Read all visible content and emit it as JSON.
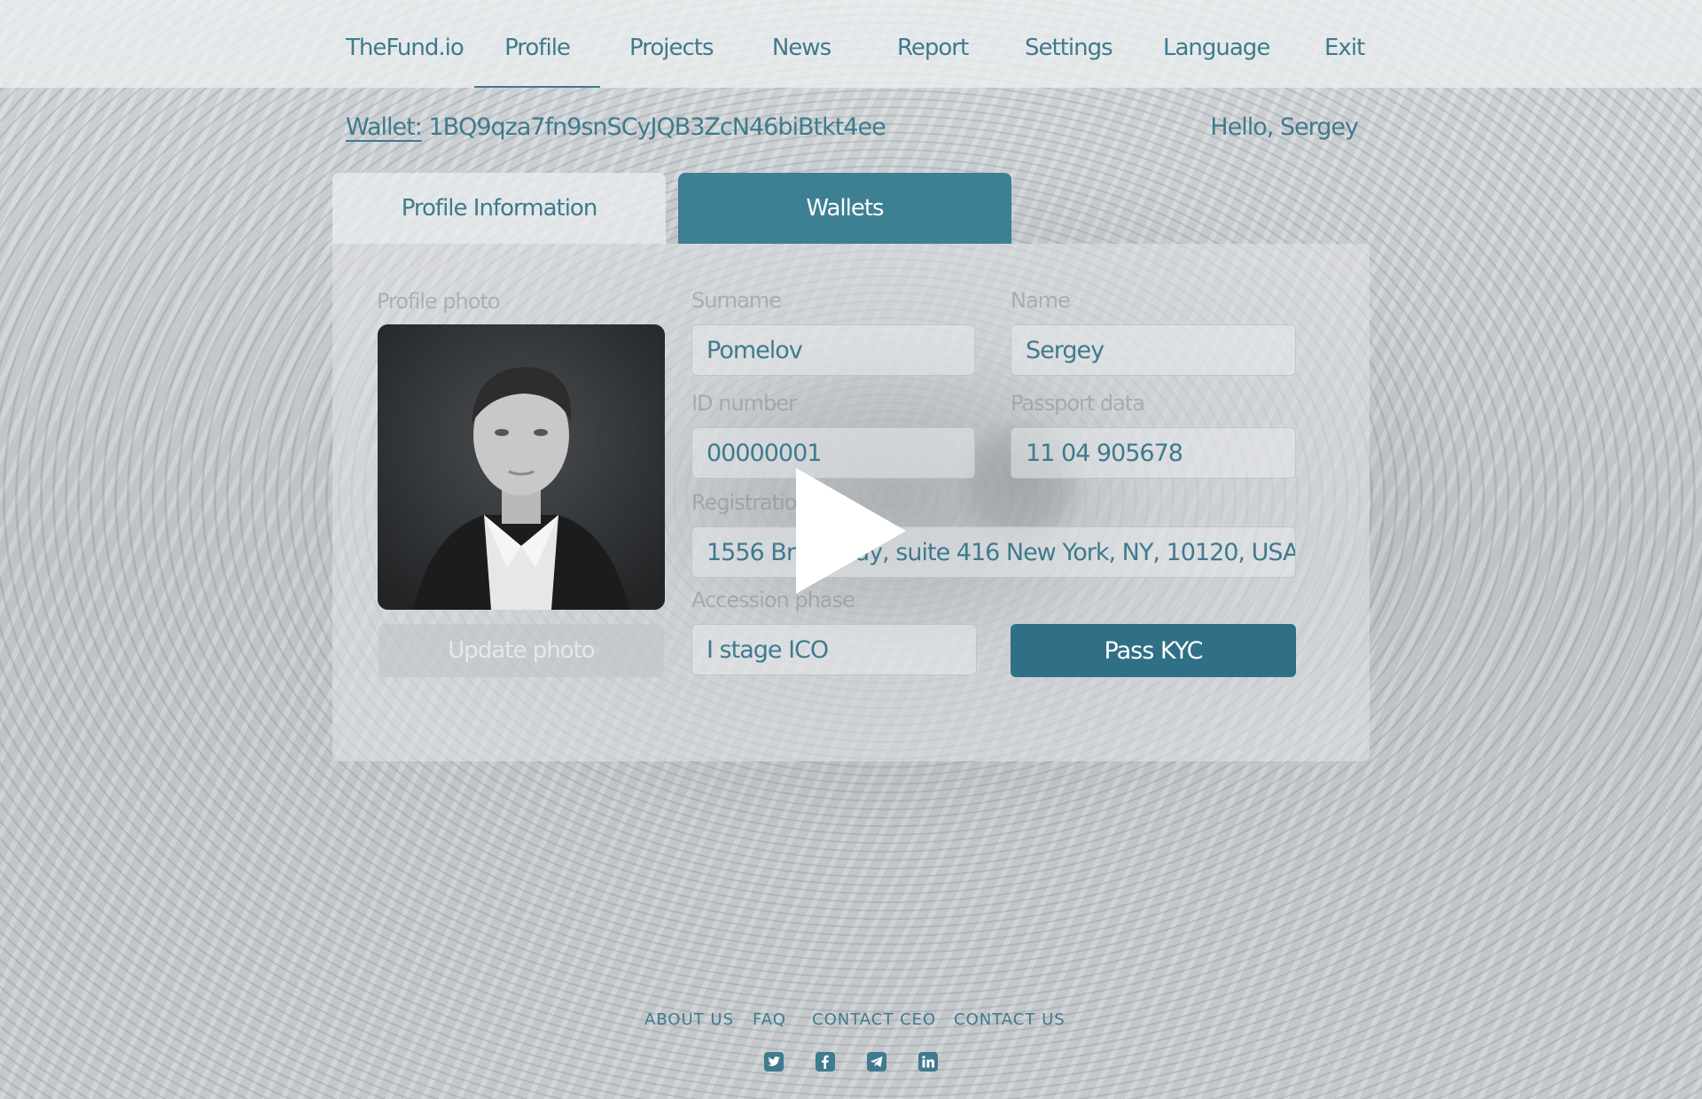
{
  "nav": {
    "brand": "TheFund.io",
    "items": [
      "Profile",
      "Projects",
      "News",
      "Report",
      "Settings",
      "Language",
      "Exit"
    ],
    "active": "Profile"
  },
  "wallet": {
    "label": "Wallet:",
    "address": "1BQ9qza7fn9snSCyJQB3ZcN46biBtkt4ee"
  },
  "greeting": "Hello, Sergey",
  "tabs": {
    "profile": "Profile Information",
    "wallets": "Wallets"
  },
  "form": {
    "photo_label": "Profile photo",
    "surname_label": "Surname",
    "surname_value": "Pomelov",
    "name_label": "Name",
    "name_value": "Sergey",
    "id_label": "ID number",
    "id_value": "00000001",
    "passport_label": "Passport data",
    "passport_value": "11 04 905678",
    "registration_label": "Registration",
    "registration_value": "1556 Broadway, suite 416 New York, NY, 10120, USA",
    "phase_label": "Accession phase",
    "phase_value": "I stage ICO",
    "update_photo": "Update photo",
    "pass_kyc": "Pass KYC"
  },
  "footer": {
    "links": [
      "ABOUT US",
      "FAQ",
      "CONTACT CEO",
      "CONTACT US"
    ],
    "social": [
      "twitter-icon",
      "facebook-icon",
      "telegram-icon",
      "linkedin-icon"
    ]
  },
  "colors": {
    "accent": "#3f7a8e",
    "button": "#2f7086"
  }
}
